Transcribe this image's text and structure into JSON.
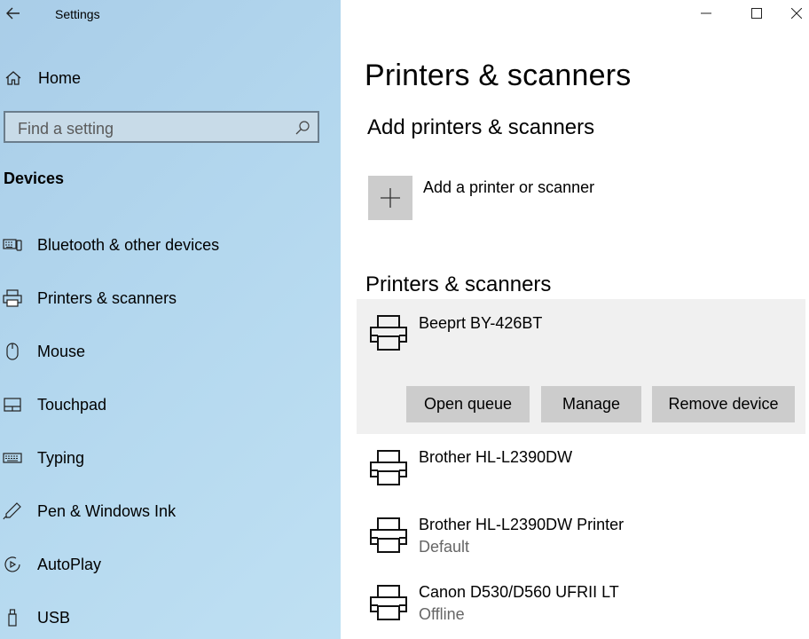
{
  "window": {
    "title": "Settings"
  },
  "sidebar": {
    "home_label": "Home",
    "search_placeholder": "Find a setting",
    "section_title": "Devices",
    "items": [
      {
        "label": "Bluetooth & other devices",
        "icon": "bluetooth-devices-icon"
      },
      {
        "label": "Printers & scanners",
        "icon": "printer-icon"
      },
      {
        "label": "Mouse",
        "icon": "mouse-icon"
      },
      {
        "label": "Touchpad",
        "icon": "touchpad-icon"
      },
      {
        "label": "Typing",
        "icon": "keyboard-icon"
      },
      {
        "label": "Pen & Windows Ink",
        "icon": "pen-icon"
      },
      {
        "label": "AutoPlay",
        "icon": "autoplay-icon"
      },
      {
        "label": "USB",
        "icon": "usb-icon"
      }
    ]
  },
  "main": {
    "title": "Printers & scanners",
    "add_section_title": "Add printers & scanners",
    "add_label": "Add a printer or scanner",
    "list_title": "Printers & scanners",
    "printers": [
      {
        "name": "Beeprt BY-426BT",
        "status": ""
      },
      {
        "name": "Brother HL-L2390DW",
        "status": ""
      },
      {
        "name": "Brother HL-L2390DW Printer",
        "status": "Default"
      },
      {
        "name": "Canon D530/D560 UFRII LT",
        "status": "Offline"
      }
    ],
    "actions": {
      "open_queue": "Open queue",
      "manage": "Manage",
      "remove": "Remove device"
    }
  }
}
